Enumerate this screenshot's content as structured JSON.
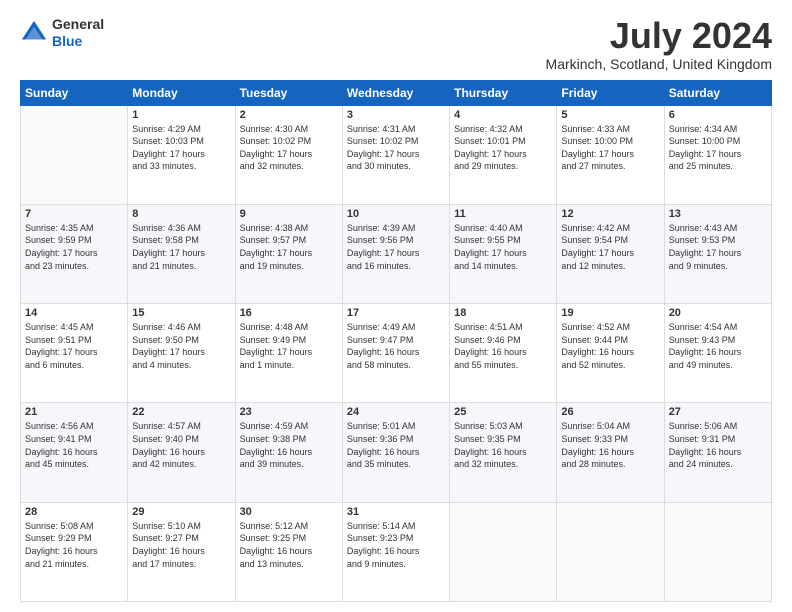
{
  "header": {
    "logo": {
      "line1": "General",
      "line2": "Blue"
    },
    "title": "July 2024",
    "location": "Markinch, Scotland, United Kingdom"
  },
  "weekdays": [
    "Sunday",
    "Monday",
    "Tuesday",
    "Wednesday",
    "Thursday",
    "Friday",
    "Saturday"
  ],
  "weeks": [
    [
      {
        "day": "",
        "info": ""
      },
      {
        "day": "1",
        "info": "Sunrise: 4:29 AM\nSunset: 10:03 PM\nDaylight: 17 hours\nand 33 minutes."
      },
      {
        "day": "2",
        "info": "Sunrise: 4:30 AM\nSunset: 10:02 PM\nDaylight: 17 hours\nand 32 minutes."
      },
      {
        "day": "3",
        "info": "Sunrise: 4:31 AM\nSunset: 10:02 PM\nDaylight: 17 hours\nand 30 minutes."
      },
      {
        "day": "4",
        "info": "Sunrise: 4:32 AM\nSunset: 10:01 PM\nDaylight: 17 hours\nand 29 minutes."
      },
      {
        "day": "5",
        "info": "Sunrise: 4:33 AM\nSunset: 10:00 PM\nDaylight: 17 hours\nand 27 minutes."
      },
      {
        "day": "6",
        "info": "Sunrise: 4:34 AM\nSunset: 10:00 PM\nDaylight: 17 hours\nand 25 minutes."
      }
    ],
    [
      {
        "day": "7",
        "info": "Sunrise: 4:35 AM\nSunset: 9:59 PM\nDaylight: 17 hours\nand 23 minutes."
      },
      {
        "day": "8",
        "info": "Sunrise: 4:36 AM\nSunset: 9:58 PM\nDaylight: 17 hours\nand 21 minutes."
      },
      {
        "day": "9",
        "info": "Sunrise: 4:38 AM\nSunset: 9:57 PM\nDaylight: 17 hours\nand 19 minutes."
      },
      {
        "day": "10",
        "info": "Sunrise: 4:39 AM\nSunset: 9:56 PM\nDaylight: 17 hours\nand 16 minutes."
      },
      {
        "day": "11",
        "info": "Sunrise: 4:40 AM\nSunset: 9:55 PM\nDaylight: 17 hours\nand 14 minutes."
      },
      {
        "day": "12",
        "info": "Sunrise: 4:42 AM\nSunset: 9:54 PM\nDaylight: 17 hours\nand 12 minutes."
      },
      {
        "day": "13",
        "info": "Sunrise: 4:43 AM\nSunset: 9:53 PM\nDaylight: 17 hours\nand 9 minutes."
      }
    ],
    [
      {
        "day": "14",
        "info": "Sunrise: 4:45 AM\nSunset: 9:51 PM\nDaylight: 17 hours\nand 6 minutes."
      },
      {
        "day": "15",
        "info": "Sunrise: 4:46 AM\nSunset: 9:50 PM\nDaylight: 17 hours\nand 4 minutes."
      },
      {
        "day": "16",
        "info": "Sunrise: 4:48 AM\nSunset: 9:49 PM\nDaylight: 17 hours\nand 1 minute."
      },
      {
        "day": "17",
        "info": "Sunrise: 4:49 AM\nSunset: 9:47 PM\nDaylight: 16 hours\nand 58 minutes."
      },
      {
        "day": "18",
        "info": "Sunrise: 4:51 AM\nSunset: 9:46 PM\nDaylight: 16 hours\nand 55 minutes."
      },
      {
        "day": "19",
        "info": "Sunrise: 4:52 AM\nSunset: 9:44 PM\nDaylight: 16 hours\nand 52 minutes."
      },
      {
        "day": "20",
        "info": "Sunrise: 4:54 AM\nSunset: 9:43 PM\nDaylight: 16 hours\nand 49 minutes."
      }
    ],
    [
      {
        "day": "21",
        "info": "Sunrise: 4:56 AM\nSunset: 9:41 PM\nDaylight: 16 hours\nand 45 minutes."
      },
      {
        "day": "22",
        "info": "Sunrise: 4:57 AM\nSunset: 9:40 PM\nDaylight: 16 hours\nand 42 minutes."
      },
      {
        "day": "23",
        "info": "Sunrise: 4:59 AM\nSunset: 9:38 PM\nDaylight: 16 hours\nand 39 minutes."
      },
      {
        "day": "24",
        "info": "Sunrise: 5:01 AM\nSunset: 9:36 PM\nDaylight: 16 hours\nand 35 minutes."
      },
      {
        "day": "25",
        "info": "Sunrise: 5:03 AM\nSunset: 9:35 PM\nDaylight: 16 hours\nand 32 minutes."
      },
      {
        "day": "26",
        "info": "Sunrise: 5:04 AM\nSunset: 9:33 PM\nDaylight: 16 hours\nand 28 minutes."
      },
      {
        "day": "27",
        "info": "Sunrise: 5:06 AM\nSunset: 9:31 PM\nDaylight: 16 hours\nand 24 minutes."
      }
    ],
    [
      {
        "day": "28",
        "info": "Sunrise: 5:08 AM\nSunset: 9:29 PM\nDaylight: 16 hours\nand 21 minutes."
      },
      {
        "day": "29",
        "info": "Sunrise: 5:10 AM\nSunset: 9:27 PM\nDaylight: 16 hours\nand 17 minutes."
      },
      {
        "day": "30",
        "info": "Sunrise: 5:12 AM\nSunset: 9:25 PM\nDaylight: 16 hours\nand 13 minutes."
      },
      {
        "day": "31",
        "info": "Sunrise: 5:14 AM\nSunset: 9:23 PM\nDaylight: 16 hours\nand 9 minutes."
      },
      {
        "day": "",
        "info": ""
      },
      {
        "day": "",
        "info": ""
      },
      {
        "day": "",
        "info": ""
      }
    ]
  ]
}
